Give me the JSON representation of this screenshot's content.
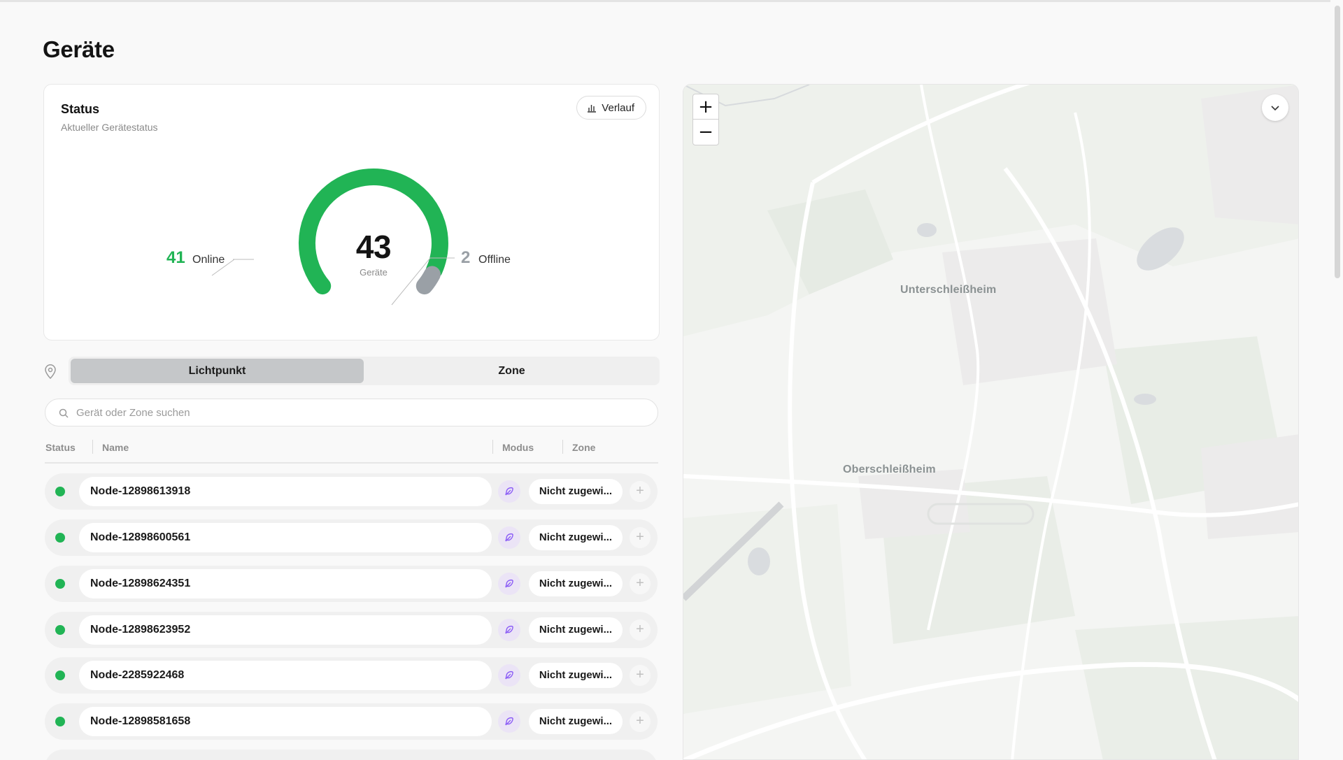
{
  "page": {
    "title": "Geräte"
  },
  "status": {
    "title": "Status",
    "subtitle": "Aktueller Gerätestatus",
    "history_button": "Verlauf",
    "total": "43",
    "total_label": "Geräte",
    "online_count": "41",
    "online_label": "Online",
    "offline_count": "2",
    "offline_label": "Offline",
    "online_fraction": 0.9535,
    "colors": {
      "online": "#21b455",
      "offline": "#9aa0a6"
    }
  },
  "view_toggle": {
    "options": [
      "Lichtpunkt",
      "Zone"
    ],
    "selected": "Lichtpunkt"
  },
  "search": {
    "placeholder": "Gerät oder Zone suchen",
    "value": ""
  },
  "table": {
    "columns": [
      "Status",
      "Name",
      "Modus",
      "Zone"
    ],
    "rows": [
      {
        "name": "Node-12898613918",
        "zone": "Nicht zugewi...",
        "status": "online"
      },
      {
        "name": "Node-12898600561",
        "zone": "Nicht zugewi...",
        "status": "online"
      },
      {
        "name": "Node-12898624351",
        "zone": "Nicht zugewi...",
        "status": "online"
      },
      {
        "name": "Node-12898623952",
        "zone": "Nicht zugewi...",
        "status": "online"
      },
      {
        "name": "Node-2285922468",
        "zone": "Nicht zugewi...",
        "status": "online"
      },
      {
        "name": "Node-12898581658",
        "zone": "Nicht zugewi...",
        "status": "online"
      }
    ]
  },
  "map": {
    "zoom_in": "+",
    "zoom_out": "−",
    "places": [
      "Unterschleißheim",
      "Oberschleißheim"
    ]
  }
}
